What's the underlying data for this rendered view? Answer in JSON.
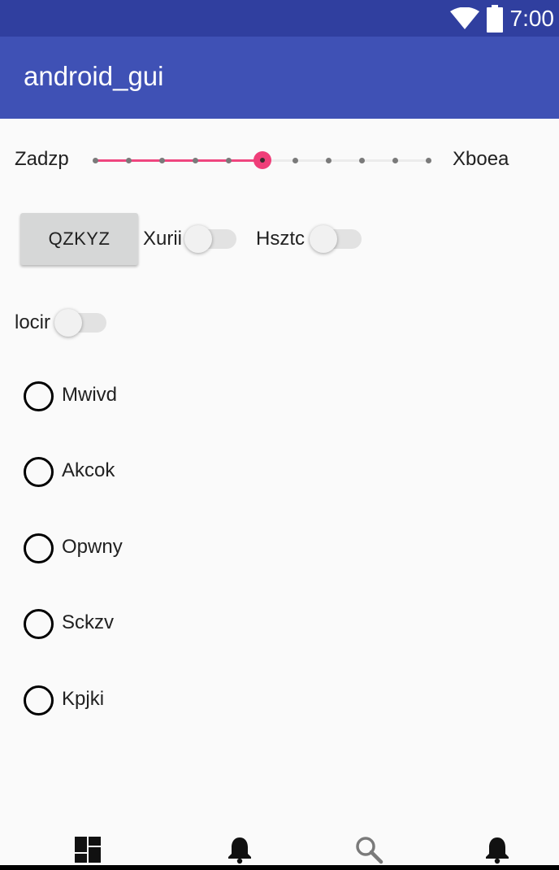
{
  "status_bar": {
    "time": "7:00",
    "icons": [
      "wifi-icon",
      "battery-icon"
    ],
    "color": "#303f9f"
  },
  "app_bar": {
    "title": "android_gui",
    "color": "#3f51b5"
  },
  "seekbar": {
    "left_label": "Zadzp",
    "right_label": "Xboea",
    "progress": 5,
    "max": 10,
    "accent": "#ef467f"
  },
  "button": {
    "label": "QZKYZ"
  },
  "switches": [
    {
      "label": "Xurii",
      "checked": false
    },
    {
      "label": "Hsztc",
      "checked": false
    },
    {
      "label": "locir",
      "checked": false
    }
  ],
  "radio_group": [
    {
      "label": "Mwivd",
      "checked": false
    },
    {
      "label": "Akcok",
      "checked": false
    },
    {
      "label": "Opwny",
      "checked": false
    },
    {
      "label": "Sckzv",
      "checked": false
    },
    {
      "label": "Kpjki",
      "checked": false
    }
  ],
  "bottom_nav": {
    "items": [
      "dashboard-icon",
      "notifications-icon",
      "search-icon",
      "notifications-icon"
    ]
  }
}
